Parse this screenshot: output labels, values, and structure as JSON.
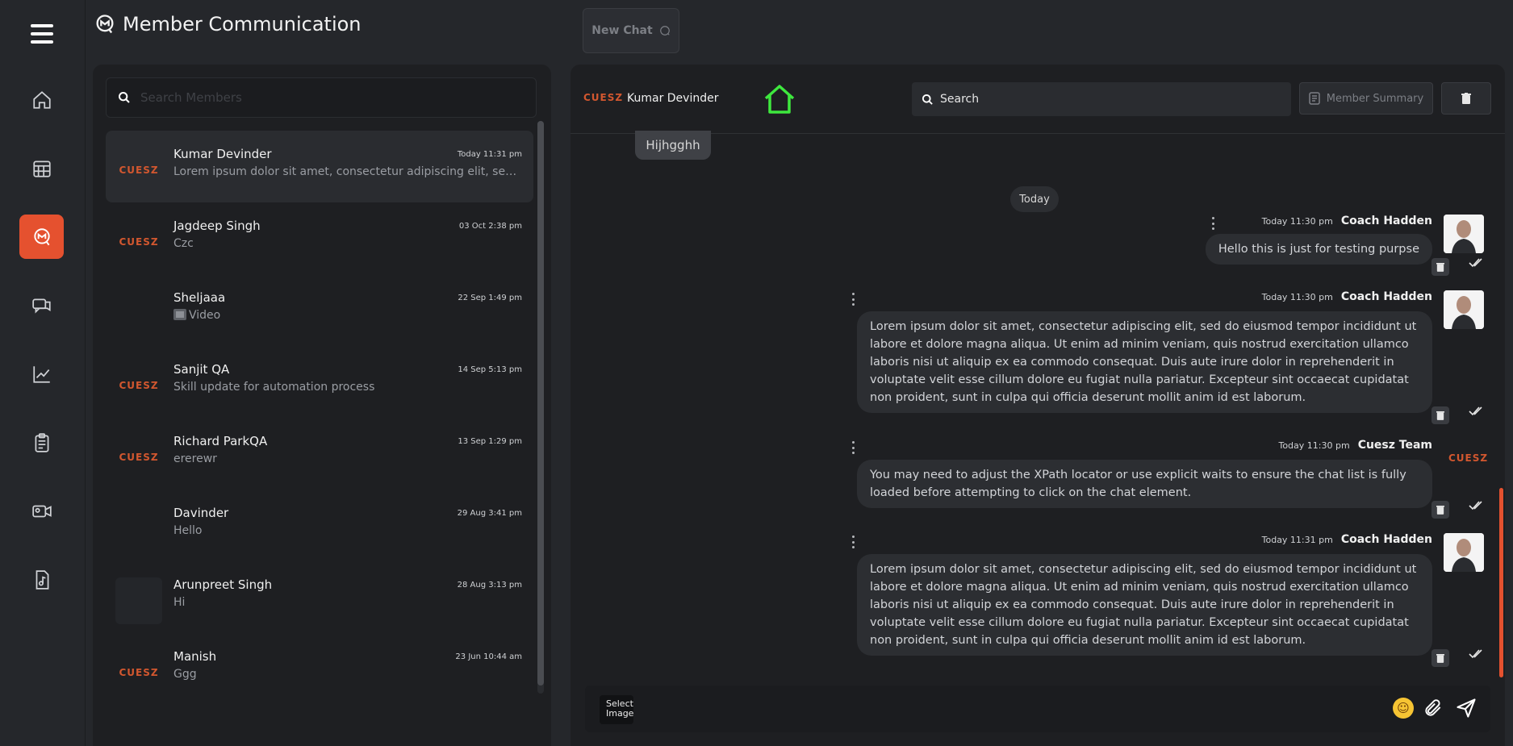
{
  "header": {
    "title": "Member Communication",
    "new_chat_label": "New Chat"
  },
  "sidebar": {
    "items": [
      {
        "icon": "home-icon"
      },
      {
        "icon": "calendar-icon"
      },
      {
        "icon": "member-chat-icon",
        "active": true
      },
      {
        "icon": "messages-icon"
      },
      {
        "icon": "analytics-icon"
      },
      {
        "icon": "clipboard-icon"
      },
      {
        "icon": "video-icon"
      },
      {
        "icon": "music-file-icon"
      }
    ]
  },
  "member_search": {
    "placeholder": "Search Members"
  },
  "members": [
    {
      "name": "Kumar Devinder",
      "time": "Today 11:31 pm",
      "preview": "Lorem ipsum dolor sit amet, consectetur adipiscing elit, sed do eiusmod tempor incididunt ut labore",
      "avatar": "cuesz-logo",
      "selected": true
    },
    {
      "name": "Jagdeep Singh",
      "time": "03 Oct 2:38 pm",
      "preview": "Czc",
      "avatar": "cuesz-logo"
    },
    {
      "name": "Sheljaaa",
      "time": "22 Sep 1:49 pm",
      "preview": "Video",
      "avatar": "none",
      "preview_icon": "video-thumbnail-icon"
    },
    {
      "name": "Sanjit QA",
      "time": "14 Sep 5:13 pm",
      "preview": "Skill update for automation process",
      "avatar": "cuesz-logo"
    },
    {
      "name": "Richard ParkQA",
      "time": "13 Sep 1:29 pm",
      "preview": "ererewr",
      "avatar": "cuesz-logo"
    },
    {
      "name": "Davinder",
      "time": "29 Aug 3:41 pm",
      "preview": "Hello",
      "avatar": "none"
    },
    {
      "name": "Arunpreet Singh",
      "time": "28 Aug 3:13 pm",
      "preview": "Hi",
      "avatar": "blank"
    },
    {
      "name": "Manish",
      "time": "23 Jun 10:44 am",
      "preview": "Ggg",
      "avatar": "cuesz-logo"
    }
  ],
  "logo_text": "CUESZ",
  "chat": {
    "contact_name": "Kumar Devinder",
    "search_placeholder": "Search",
    "member_summary_label": "Member Summary",
    "previous_message": "Hijhgghh",
    "day_separator": "Today",
    "messages": [
      {
        "time": "Today 11:30 pm",
        "sender": "Coach Hadden",
        "text": "Hello this is just for testing purpse",
        "avatar": "coach-photo"
      },
      {
        "time": "Today 11:30 pm",
        "sender": "Coach Hadden",
        "text": "Lorem ipsum dolor sit amet, consectetur adipiscing elit, sed do eiusmod tempor incididunt ut labore et dolore magna aliqua. Ut enim ad minim veniam, quis nostrud exercitation ullamco laboris nisi ut aliquip ex ea commodo consequat. Duis aute irure dolor in reprehenderit in voluptate velit esse cillum dolore eu fugiat nulla pariatur. Excepteur sint occaecat cupidatat non proident, sunt in culpa qui officia deserunt mollit anim id est laborum.",
        "avatar": "coach-photo"
      },
      {
        "time": "Today 11:30 pm",
        "sender": "Cuesz Team",
        "text": "You may need to adjust the XPath locator or use explicit waits to ensure the chat list is fully loaded before attempting to click on the chat element.",
        "avatar": "cuesz-logo"
      },
      {
        "time": "Today 11:31 pm",
        "sender": "Coach Hadden",
        "text": "Lorem ipsum dolor sit amet, consectetur adipiscing elit, sed do eiusmod tempor incididunt ut labore et dolore magna aliqua. Ut enim ad minim veniam, quis nostrud exercitation ullamco laboris nisi ut aliquip ex ea commodo consequat. Duis aute irure dolor in reprehenderit in voluptate velit esse cillum dolore eu fugiat nulla pariatur. Excepteur sint occaecat cupidatat non proident, sunt in culpa qui officia deserunt mollit anim id est laborum.",
        "avatar": "coach-photo"
      }
    ]
  },
  "composer": {
    "select_image_label": "Select Image",
    "input_value": ""
  },
  "colors": {
    "accent": "#e5512f",
    "home_green": "#3ee83e",
    "background": "#25272b",
    "panel": "#1e1f22"
  }
}
